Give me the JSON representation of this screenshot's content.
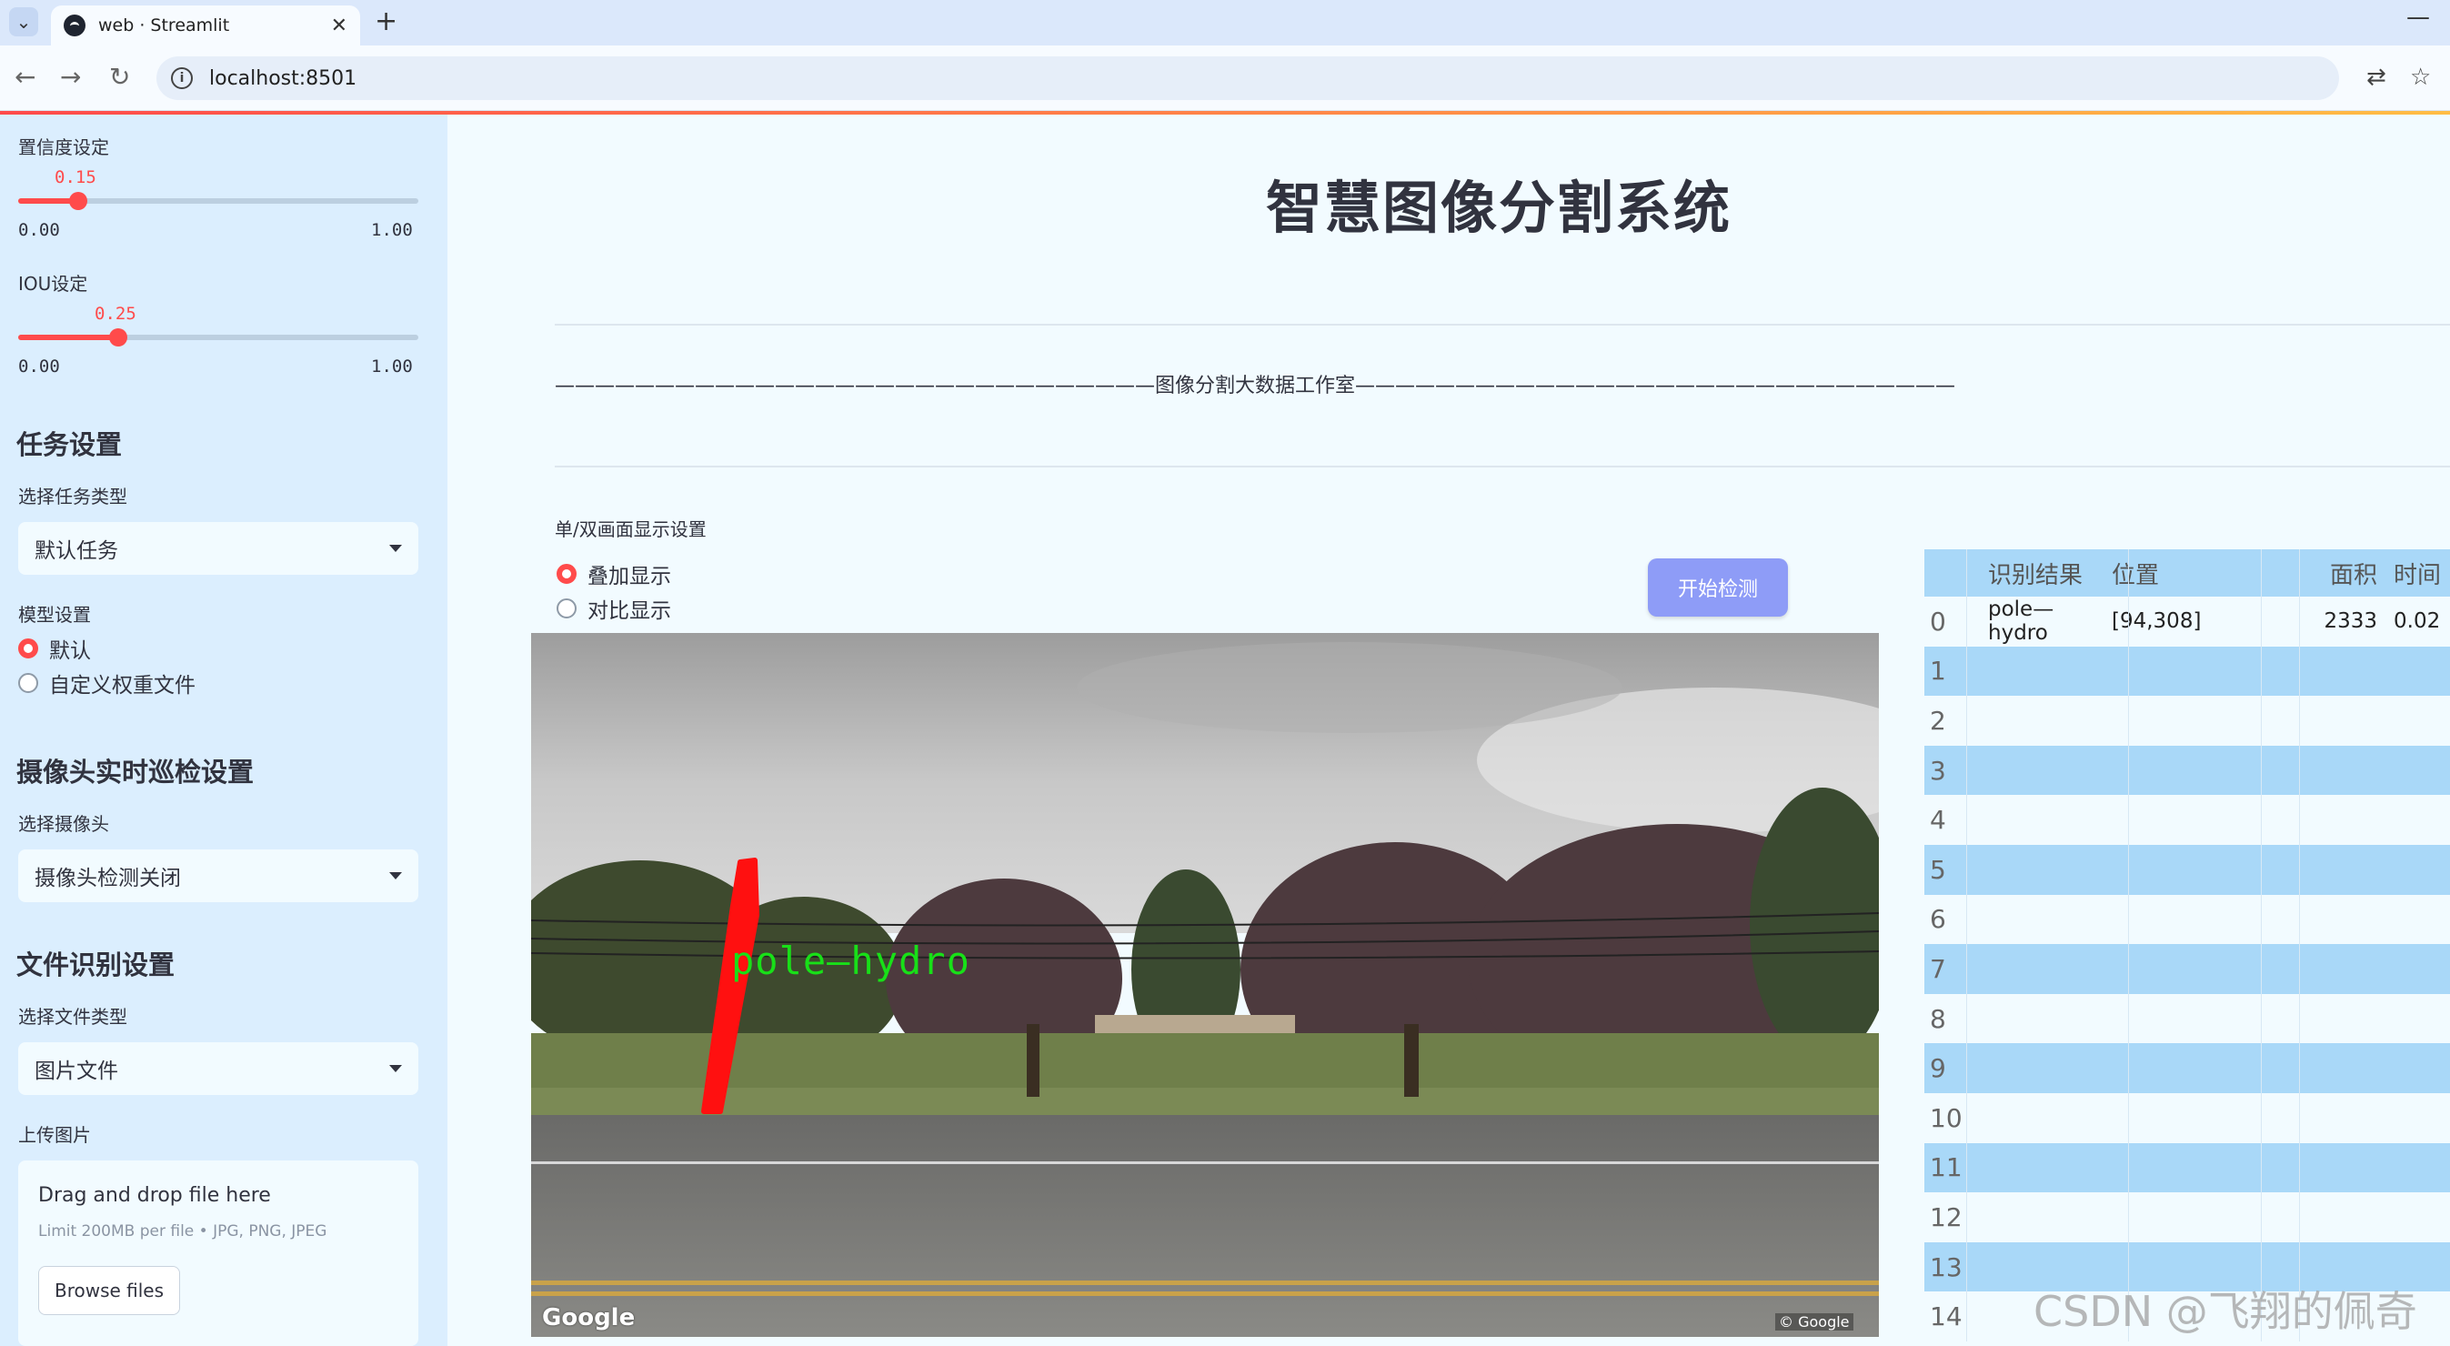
{
  "browser": {
    "tab_title": "web · Streamlit",
    "url": "localhost:8501"
  },
  "sidebar": {
    "confidence": {
      "label": "置信度设定",
      "value": "0.15",
      "min": "0.00",
      "max": "1.00",
      "fraction": 0.15
    },
    "iou": {
      "label": "IOU设定",
      "value": "0.25",
      "min": "0.00",
      "max": "1.00",
      "fraction": 0.25
    },
    "task_header": "任务设置",
    "task_type_label": "选择任务类型",
    "task_type_value": "默认任务",
    "model_label": "模型设置",
    "model_options": [
      "默认",
      "自定义权重文件"
    ],
    "model_selected": "默认",
    "camera_header": "摄像头实时巡检设置",
    "camera_label": "选择摄像头",
    "camera_value": "摄像头检测关闭",
    "file_header": "文件识别设置",
    "file_type_label": "选择文件类型",
    "file_type_value": "图片文件",
    "upload_label": "上传图片",
    "uploader": {
      "drop_text": "Drag and drop file here",
      "limit_text": "Limit 200MB per file • JPG, PNG, JPEG",
      "browse_label": "Browse files"
    }
  },
  "main": {
    "title": "智慧图像分割系统",
    "studio_line": "——————————————————————————————图像分割大数据工作室——————————————————————————————",
    "display_label": "单/双画面显示设置",
    "display_options": [
      "叠加显示",
      "对比显示"
    ],
    "display_selected": "叠加显示",
    "start_button": "开始检测",
    "detection_label": "pole—hydro",
    "google_mark": "Google",
    "google_copy": "© Google"
  },
  "table": {
    "columns": [
      "识别结果",
      "位置",
      "面积",
      "时间"
    ],
    "rows": [
      {
        "idx": "0",
        "result": "pole—hydro",
        "position": "[94,308]",
        "area": "2333",
        "time": "0.02"
      },
      {
        "idx": "1"
      },
      {
        "idx": "2"
      },
      {
        "idx": "3"
      },
      {
        "idx": "4"
      },
      {
        "idx": "5"
      },
      {
        "idx": "6"
      },
      {
        "idx": "7"
      },
      {
        "idx": "8"
      },
      {
        "idx": "9"
      },
      {
        "idx": "10"
      },
      {
        "idx": "11"
      },
      {
        "idx": "12"
      },
      {
        "idx": "13"
      },
      {
        "idx": "14"
      }
    ]
  },
  "watermark": "CSDN @飞翔的佩奇",
  "colors": {
    "accent": "#ff4b4b",
    "sidebar_bg": "#dbeefe",
    "main_bg": "#f2fbff",
    "button": "#8e9cf7",
    "table_band": "#a9d8f8"
  }
}
